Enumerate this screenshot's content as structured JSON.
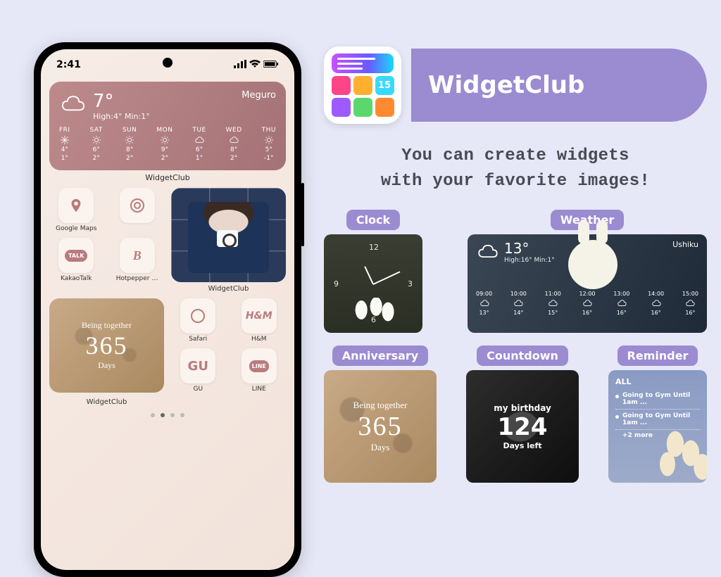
{
  "phone": {
    "status_time": "2:41",
    "weather_widget": {
      "temp": "7°",
      "city": "Meguro",
      "highlow": "High:4° Min:1°",
      "label_below": "WidgetClub",
      "days": [
        {
          "d": "FRI",
          "hi": "4°",
          "lo": "1°"
        },
        {
          "d": "SAT",
          "hi": "6°",
          "lo": "2°"
        },
        {
          "d": "SUN",
          "hi": "8°",
          "lo": "2°"
        },
        {
          "d": "MON",
          "hi": "9°",
          "lo": "2°"
        },
        {
          "d": "TUE",
          "hi": "6°",
          "lo": "1°"
        },
        {
          "d": "WED",
          "hi": "8°",
          "lo": "2°"
        },
        {
          "d": "THU",
          "hi": "5°",
          "lo": "-1°"
        }
      ]
    },
    "apps": {
      "maps": "Google Maps",
      "shazam": "",
      "kakao": "KakaoTalk",
      "kakao_badge": "TALK",
      "hotpepper": "Hotpepper be",
      "hotpepper_glyph": "B",
      "photo_label": "WidgetClub",
      "safari": "Safari",
      "hm": "H&M",
      "hm_glyph": "H&M",
      "gu": "GU",
      "gu_glyph": "GU",
      "line": "LINE",
      "line_badge": "LINE"
    },
    "anniversary": {
      "title": "Being together",
      "number": "365",
      "unit": "Days",
      "label_below": "WidgetClub"
    }
  },
  "brand": {
    "name": "WidgetClub",
    "tile_number": "15"
  },
  "tagline_l1": "You can create widgets",
  "tagline_l2": "with your favorite images!",
  "categories": {
    "clock": {
      "label": "Clock",
      "n12": "12",
      "n3": "3",
      "n6": "6",
      "n9": "9"
    },
    "weather": {
      "label": "Weather",
      "temp": "13°",
      "city": "Ushiku",
      "highlow": "High:16° Min:1°",
      "hours": [
        {
          "h": "09:00",
          "t": "13°"
        },
        {
          "h": "10:00",
          "t": "14°"
        },
        {
          "h": "11:00",
          "t": "15°"
        },
        {
          "h": "12:00",
          "t": "16°"
        },
        {
          "h": "13:00",
          "t": "16°"
        },
        {
          "h": "14:00",
          "t": "16°"
        },
        {
          "h": "15:00",
          "t": "16°"
        }
      ]
    },
    "anniversary": {
      "label": "Anniversary",
      "title": "Being together",
      "number": "365",
      "unit": "Days"
    },
    "countdown": {
      "label": "Countdown",
      "title": "my birthday",
      "number": "124",
      "unit": "Days left"
    },
    "reminder": {
      "label": "Reminder",
      "heading": "ALL",
      "item1": "Going to Gym Until 1am ...",
      "item2": "Going to Gym Until 1am ...",
      "more": "+2 more"
    }
  }
}
